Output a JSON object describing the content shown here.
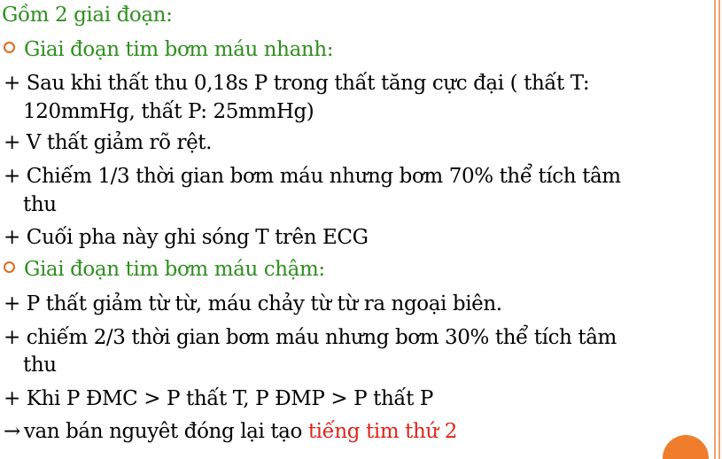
{
  "colors": {
    "heading_green": "#2f8f1f",
    "highlight_red": "#e0241c",
    "bullet_orange": "#e06a1a",
    "border_orange": "#f2a46f",
    "circle_orange": "#f07d2b"
  },
  "intro": "Gồm 2 giai đoạn:",
  "phase_fast": {
    "heading": "Giai đoạn tim bơm máu nhanh:",
    "items": [
      "+ Sau khi thất thu 0,18s P trong thất tăng cực đại ( thất T:",
      "120mmHg, thất P: 25mmHg)",
      "+ V thất giảm rõ rệt.",
      "+ Chiếm 1/3 thời gian bơm máu nhưng bơm 70% thể tích tâm",
      "thu",
      "+ Cuối pha này ghi sóng T trên ECG"
    ]
  },
  "phase_slow": {
    "heading": "Giai đoạn tim bơm máu chậm:",
    "items": [
      "+ P thất giảm từ từ, máu chảy từ từ ra ngoại biên.",
      "+ chiếm 2/3 thời gian bơm máu nhưng bơm 30% thể tích tâm",
      "thu",
      "+ Khi P ĐMC > P thất T, P ĐMP > P thất P"
    ]
  },
  "conclusion": {
    "arrow": "→",
    "text": "van bán nguyêt đóng lại tạo ",
    "highlight": "tiếng tim thứ 2"
  }
}
